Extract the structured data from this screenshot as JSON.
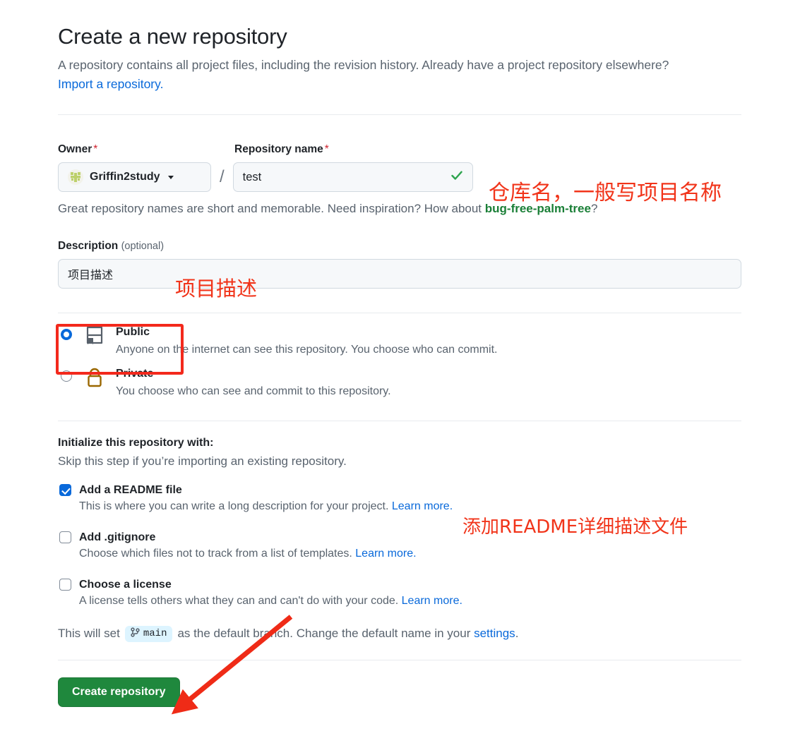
{
  "page": {
    "title": "Create a new repository",
    "subtitle_text": "A repository contains all project files, including the revision history. Already have a project repository elsewhere?",
    "import_link": "Import a repository."
  },
  "owner": {
    "label": "Owner",
    "required_mark": "*",
    "value": "Griffin2study",
    "avatar_icon": "identicon-avatar",
    "caret_icon": "chevron-down-icon"
  },
  "separator": "/",
  "repo_name": {
    "label": "Repository name",
    "required_mark": "*",
    "value": "test",
    "valid_icon": "check-icon",
    "hint_prefix": "Great repository names are short and memorable. Need inspiration? How about ",
    "hint_suggestion": "bug-free-palm-tree",
    "hint_suffix": "?"
  },
  "description": {
    "label": "Description",
    "optional": "(optional)",
    "value": "项目描述"
  },
  "visibility": {
    "options": [
      {
        "name": "Public",
        "description": "Anyone on the internet can see this repository. You choose who can commit.",
        "icon": "book-icon",
        "selected": true
      },
      {
        "name": "Private",
        "description": "You choose who can see and commit to this repository.",
        "icon": "lock-icon",
        "selected": false
      }
    ]
  },
  "initialize": {
    "title": "Initialize this repository with:",
    "subtitle": "Skip this step if you’re importing an existing repository.",
    "options": [
      {
        "name": "Add a README file",
        "description": "This is where you can write a long description for your project. ",
        "learn_more": "Learn more.",
        "checked": true
      },
      {
        "name": "Add .gitignore",
        "description": "Choose which files not to track from a list of templates. ",
        "learn_more": "Learn more.",
        "checked": false
      },
      {
        "name": "Choose a license",
        "description": "A license tells others what they can and can't do with your code. ",
        "learn_more": "Learn more.",
        "checked": false
      }
    ]
  },
  "default_branch": {
    "prefix": "This will set",
    "branch_icon": "git-branch-icon",
    "branch_name": "main",
    "middle": "as the default branch. Change the default name in your",
    "settings_link": "settings",
    "period": "."
  },
  "submit": {
    "label": "Create repository"
  },
  "annotations": {
    "repo_name_note": "仓库名，一般写项目名称",
    "description_note": "项目描述",
    "readme_note": "添加README详细描述文件",
    "highlight_box": "public-option-highlight",
    "arrow": "arrow-to-create-button"
  },
  "colors": {
    "accent_link": "#0969da",
    "annotation_red": "#f1341a",
    "success_green": "#1f883d",
    "suggestion_green": "#1a7f37",
    "required_red": "#cf222e",
    "muted_text": "#59636e"
  }
}
